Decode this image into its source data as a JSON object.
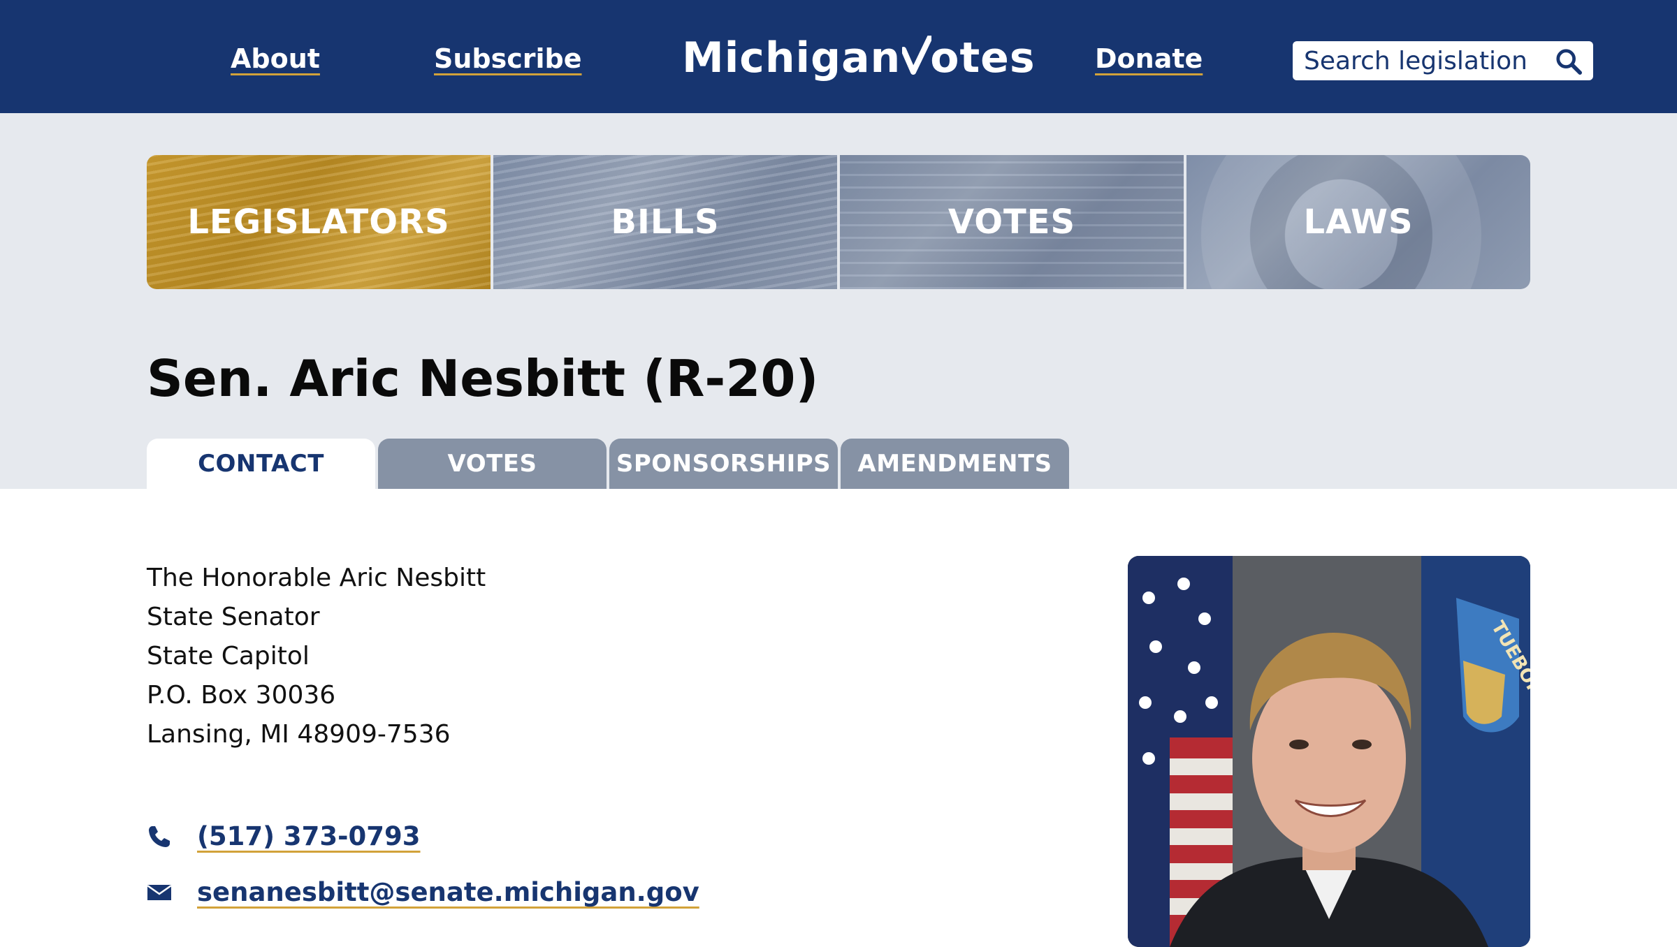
{
  "header": {
    "nav": {
      "about": "About",
      "subscribe": "Subscribe",
      "donate": "Donate"
    },
    "logo": {
      "part1": "Michigan",
      "part2": "otes"
    },
    "search": {
      "placeholder": "Search legislation",
      "icon": "search-icon"
    },
    "colors": {
      "navy": "#173570",
      "gold": "#d2a23a"
    }
  },
  "categories": [
    {
      "label": "LEGISLATORS",
      "active": true
    },
    {
      "label": "BILLS",
      "active": false
    },
    {
      "label": "VOTES",
      "active": false
    },
    {
      "label": "LAWS",
      "active": false
    }
  ],
  "legislator": {
    "title": "Sen. Aric Nesbitt (R-20)"
  },
  "tabs": [
    {
      "label": "CONTACT",
      "active": true
    },
    {
      "label": "VOTES",
      "active": false
    },
    {
      "label": "SPONSORSHIPS",
      "active": false
    },
    {
      "label": "AMENDMENTS",
      "active": false
    }
  ],
  "contact": {
    "address_lines": [
      "The Honorable Aric Nesbitt",
      "State Senator",
      "State Capitol",
      "P.O. Box 30036",
      "Lansing, MI 48909-7536"
    ],
    "phone": "(517) 373-0793",
    "phone_icon": "phone-icon",
    "email": "senanesbitt@senate.michigan.gov",
    "email_icon": "envelope-icon"
  },
  "photo": {
    "flag_text": "TUEBOR"
  }
}
